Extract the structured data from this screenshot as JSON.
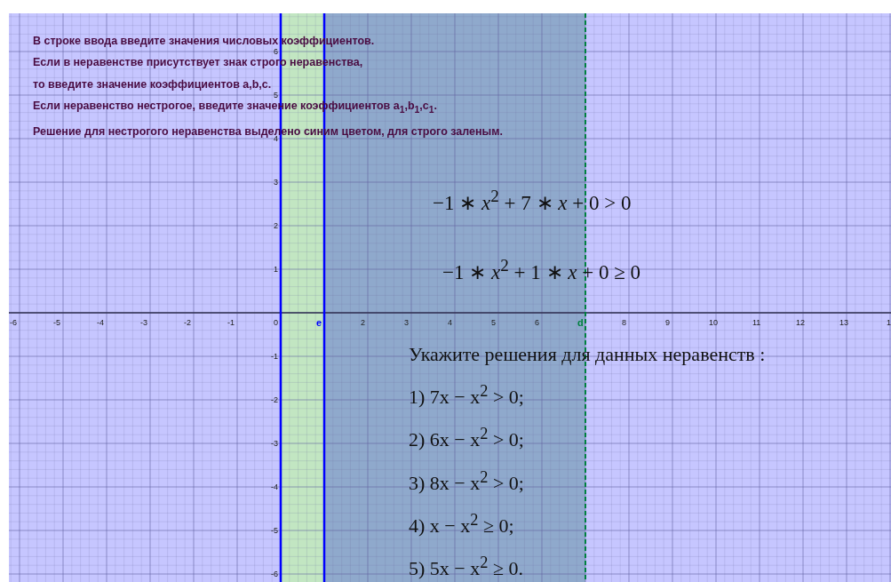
{
  "instructions": [
    "В строке ввода введите значения числовых коэффициентов.",
    "Если в неравенстве присутствует знак строго неравенства,",
    "то введите значение коэффициентов a,b,c.",
    "Если неравенство нестрогое, введите значение коэффициентов a$_{1}$,b$_{1}$,c$_{1}$.",
    "Решение для нестрогого неравенства выделено синим цветом, для строго заленым."
  ],
  "inequalities": [
    "−1 ∗ *x*$^{2}$ + 7 ∗ *x* + 0 > 0",
    "−1 ∗ *x*$^{2}$ + 1 ∗ *x* + 0 ≥ 0"
  ],
  "task": {
    "title": "Укажите решения для данных неравенств :",
    "items": [
      "1) 7x − x$^{2}$ > 0;",
      "2) 6x − x$^{2}$ > 0;",
      "3) 8x − x$^{2}$ > 0;",
      "4) x − x$^{2}$ ≥ 0;",
      "5) 5x − x$^{2}$ ≥ 0."
    ]
  },
  "axes": {
    "x_labels": [
      "-6",
      "-5",
      "-4",
      "-3",
      "-2",
      "-1",
      "0",
      "2",
      "3",
      "4",
      "5",
      "6",
      "8",
      "9",
      "10",
      "11",
      "12",
      "13",
      "1"
    ],
    "y_labels": [
      "6",
      "5",
      "4",
      "3",
      "2",
      "1",
      "-1",
      "-2",
      "-3",
      "-4",
      "-5",
      "-6"
    ]
  },
  "regions": [
    {
      "kind": "band",
      "color": "#c2e6c2"
    },
    {
      "kind": "band",
      "color": "#8fa9cc"
    }
  ],
  "lines": [
    {
      "kind": "solid",
      "color": "#0000ff"
    },
    {
      "kind": "solid",
      "color": "#0000ff"
    },
    {
      "kind": "dashed",
      "color": "#008040"
    }
  ],
  "points": [
    {
      "label": "e",
      "color": "#0000ff"
    },
    {
      "label": "d",
      "color": "#008040"
    }
  ]
}
